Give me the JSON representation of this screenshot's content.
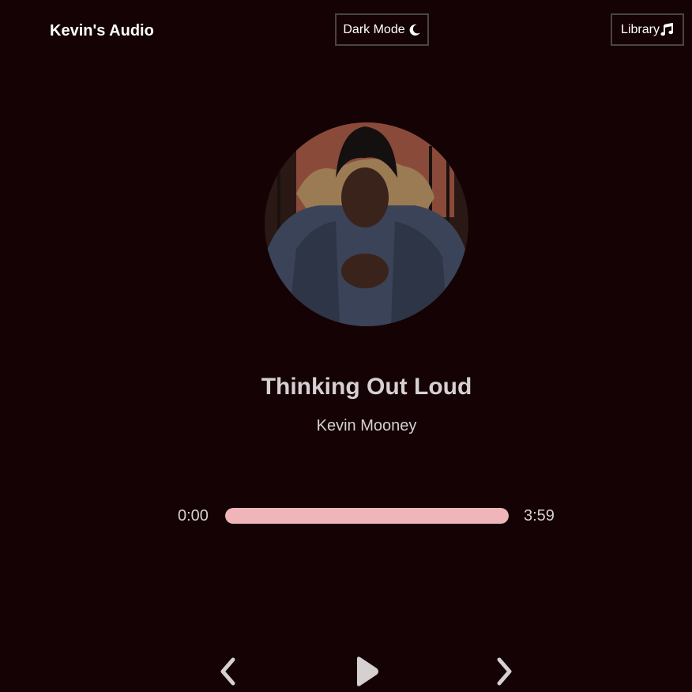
{
  "header": {
    "brand": "Kevin's Audio",
    "dark_mode_label": "Dark Mode",
    "library_label": "Library"
  },
  "track": {
    "title": "Thinking Out Loud",
    "artist": "Kevin Mooney"
  },
  "player": {
    "current_time": "0:00",
    "duration": "3:59",
    "progress": 1.0
  },
  "icons": {
    "dark_mode": "moon-icon",
    "library": "music-note-icon",
    "prev": "chevron-left-icon",
    "play": "play-icon",
    "next": "chevron-right-icon"
  },
  "colors": {
    "background": "#140205",
    "accent": "#f0b5b9",
    "text": "#d6d0d2"
  }
}
